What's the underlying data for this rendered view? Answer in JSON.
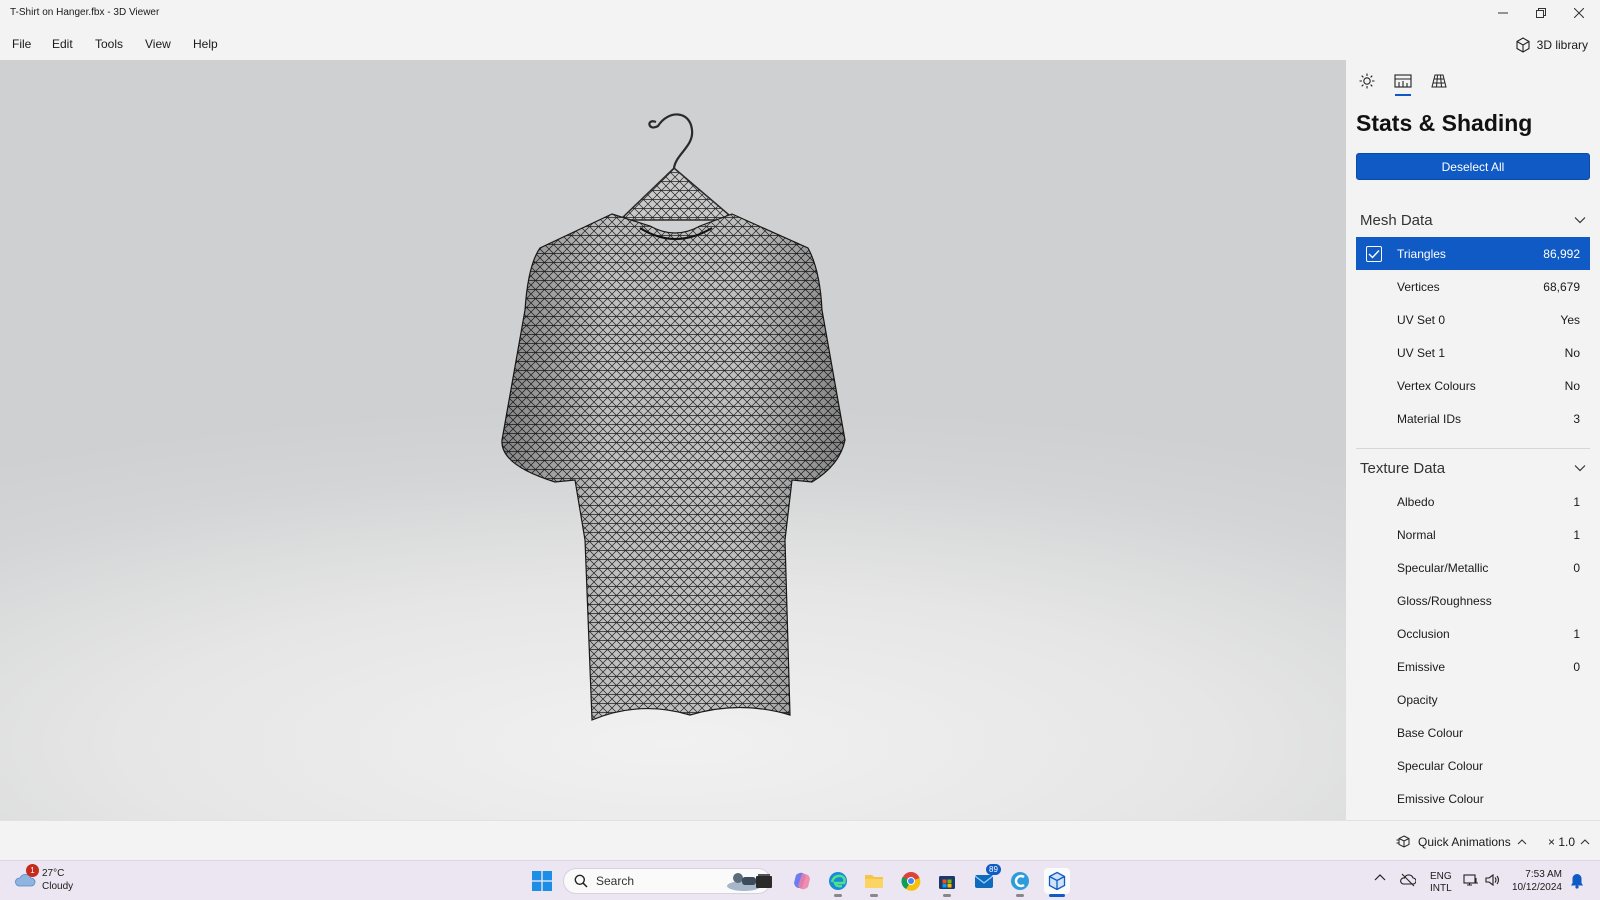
{
  "window": {
    "title": "T-Shirt on Hanger.fbx - 3D Viewer"
  },
  "menu": {
    "items": [
      "File",
      "Edit",
      "Tools",
      "View",
      "Help"
    ],
    "library_label": "3D library"
  },
  "panel": {
    "tabs": [
      "lighting-icon",
      "stats-icon",
      "grid-icon"
    ],
    "title": "Stats & Shading",
    "deselect_label": "Deselect All",
    "mesh_section": "Mesh Data",
    "mesh_rows": [
      {
        "name": "Triangles",
        "value": "86,992",
        "selected": true
      },
      {
        "name": "Vertices",
        "value": "68,679"
      },
      {
        "name": "UV Set 0",
        "value": "Yes"
      },
      {
        "name": "UV Set 1",
        "value": "No"
      },
      {
        "name": "Vertex Colours",
        "value": "No"
      },
      {
        "name": "Material IDs",
        "value": "3"
      }
    ],
    "texture_section": "Texture Data",
    "texture_rows": [
      {
        "name": "Albedo",
        "value": "1"
      },
      {
        "name": "Normal",
        "value": "1"
      },
      {
        "name": "Specular/Metallic",
        "value": "0"
      },
      {
        "name": "Gloss/Roughness",
        "value": ""
      },
      {
        "name": "Occlusion",
        "value": "1"
      },
      {
        "name": "Emissive",
        "value": "0"
      },
      {
        "name": "Opacity",
        "value": ""
      },
      {
        "name": "Base Colour",
        "value": ""
      },
      {
        "name": "Specular Colour",
        "value": ""
      },
      {
        "name": "Emissive Colour",
        "value": ""
      }
    ]
  },
  "status": {
    "quick_animations": "Quick Animations",
    "speed": "× 1.0"
  },
  "taskbar": {
    "weather_badge": "1",
    "temperature": "27°C",
    "condition": "Cloudy",
    "search_placeholder": "Search",
    "mail_badge": "89",
    "language": "ENG",
    "layout": "INTL",
    "time": "7:53 AM",
    "date": "10/12/2024"
  },
  "colors": {
    "accent": "#0f5ac4",
    "taskbar": "#ebe6f1"
  }
}
